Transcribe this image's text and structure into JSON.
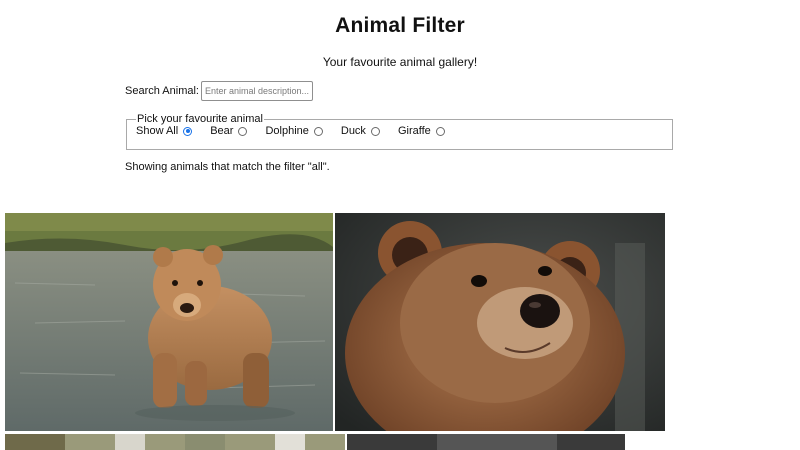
{
  "page": {
    "title": "Animal Filter",
    "subtitle": "Your favourite animal gallery!"
  },
  "search": {
    "label": "Search Animal:",
    "placeholder": "Enter animal description...",
    "value": ""
  },
  "filter": {
    "legend": "Pick your favourite animal",
    "options": [
      {
        "label": "Show All",
        "checked": true
      },
      {
        "label": "Bear",
        "checked": false
      },
      {
        "label": "Dolphine",
        "checked": false
      },
      {
        "label": "Duck",
        "checked": false
      },
      {
        "label": "Giraffe",
        "checked": false
      }
    ]
  },
  "status": {
    "text": "Showing animals that match the filter \"all\"."
  },
  "gallery": {
    "images": [
      {
        "subject": "bear-standing-in-river",
        "kind": "bear"
      },
      {
        "subject": "bear-portrait-closeup",
        "kind": "bear"
      },
      {
        "subject": "animal-photo-row2-left",
        "kind": "unknown"
      },
      {
        "subject": "animal-photo-row2-right",
        "kind": "unknown"
      }
    ]
  },
  "colors": {
    "accent": "#1a73e8",
    "border": "#a9a9a9",
    "bear_fur": "#b07a4a",
    "water": "#6f7a78"
  }
}
